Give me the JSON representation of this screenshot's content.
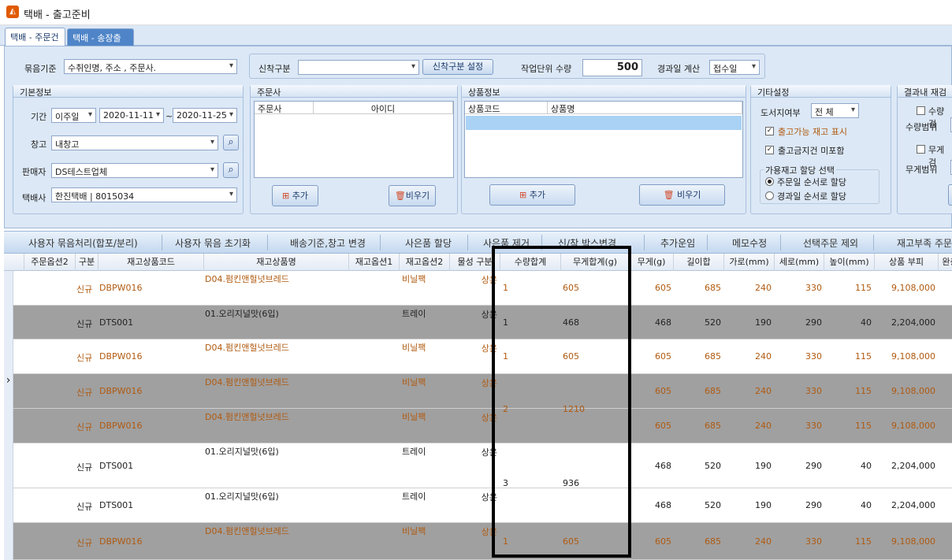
{
  "window": {
    "title": "택배 - 출고준비",
    "icon": "app-logo-icon"
  },
  "tabs": [
    {
      "label": "택배 - 주문건",
      "active": true
    },
    {
      "label": "택배 - 송장출력",
      "active": false
    }
  ],
  "top": {
    "grouping_label": "묶음기준",
    "grouping_value": "수취인명, 주소 , 주문사.",
    "newchak_label": "신착구분",
    "newchak_value": "",
    "newchak_btn": "신착구분 설정",
    "work_unit_label": "작업단위 수량",
    "work_unit_value": "500",
    "elapsed_label": "경과일 계산",
    "elapsed_value": "접수일"
  },
  "basic": {
    "title": "기본정보",
    "period_label": "기간",
    "period_preset": "이주일",
    "date_from": "2020-11-11",
    "tilde": "~",
    "date_to": "2020-11-25",
    "warehouse_label": "창고",
    "warehouse_value": "내창고",
    "seller_label": "판매자",
    "seller_value": "DS테스트업체",
    "courier_label": "택배사",
    "courier_value": "한진택배 | 8015034"
  },
  "orderer": {
    "title": "주문사",
    "col1": "주문사",
    "col2": "아이디",
    "add": "추가",
    "clear": "비우기"
  },
  "product": {
    "title": "상품정보",
    "col1": "상품코드",
    "col2": "상품명",
    "add": "추가",
    "clear": "비우기"
  },
  "etc": {
    "title": "기타설정",
    "island_label": "도서지여부",
    "island_value": "전  체",
    "show_stock": "출고가능 재고 표시",
    "exclude_hold": "출고금지건 미포함",
    "alloc_title": "가용재고 할당 선택",
    "alloc_order": "주문일 순서로 할당",
    "alloc_elapsed": "경과일 순서로 할당"
  },
  "result": {
    "title": "결과내 재검",
    "qty_check": "수량검",
    "qty_range": "수량범위",
    "weight_check": "무게검",
    "weight_range": "무게범위"
  },
  "actions": [
    "사용자 묶음처리(합포/분리)",
    "사용자 묶음 초기화",
    "배송기준,창고 변경",
    "사은품 할당",
    "사은품 제거",
    "신/착 박스변경",
    "추가운임",
    "메모수정",
    "선택주문 제외",
    "재고부족 주문"
  ],
  "columns": [
    "주문옵션2",
    "구분",
    "재고상품코드",
    "재고상품명",
    "재고옵션1",
    "재고옵션2",
    "물성 구분",
    "수량합계",
    "무게합계(g)",
    "무게(g)",
    "길이합",
    "가로(mm)",
    "세로(mm)",
    "높이(mm)",
    "상품 부피",
    "완충"
  ],
  "rows": [
    {
      "bg": "white",
      "tone": "brown",
      "type": "신규",
      "code": "DBPW016",
      "name": "D04.펌킨앤헐넛브레드",
      "opt2": "비닐팩",
      "prop": "상온",
      "qty": "1",
      "wsum": "605",
      "w": "605",
      "len": "685",
      "wd": "240",
      "ht": "330",
      "dp": "115",
      "vol": "9,108,000"
    },
    {
      "bg": "gray",
      "tone": "dark",
      "type": "신규",
      "code": "DTS001",
      "name": "01.오리지널맛(6입)",
      "opt2": "트레이",
      "prop": "상온",
      "qty": "1",
      "wsum": "468",
      "w": "468",
      "len": "520",
      "wd": "190",
      "ht": "290",
      "dp": "40",
      "vol": "2,204,000"
    },
    {
      "bg": "white",
      "tone": "brown",
      "type": "신규",
      "code": "DBPW016",
      "name": "D04.펌킨앤헐넛브레드",
      "opt2": "비닐팩",
      "prop": "상온",
      "qty": "1",
      "wsum": "605",
      "w": "605",
      "len": "685",
      "wd": "240",
      "ht": "330",
      "dp": "115",
      "vol": "9,108,000"
    },
    {
      "bg": "gray",
      "tone": "brown",
      "type": "신규",
      "code": "DBPW016",
      "name": "D04.펌킨앤헐넛브레드",
      "opt2": "비닐팩",
      "prop": "상온",
      "qty": "",
      "wsum": "",
      "w": "605",
      "len": "685",
      "wd": "240",
      "ht": "330",
      "dp": "115",
      "vol": "9,108,000"
    },
    {
      "bg": "gray",
      "tone": "brown",
      "type": "신규",
      "code": "DBPW016",
      "name": "D04.펌킨앤헐넛브레드",
      "opt2": "비닐팩",
      "prop": "상온",
      "qty": "",
      "wsum": "",
      "w": "605",
      "len": "685",
      "wd": "240",
      "ht": "330",
      "dp": "115",
      "vol": "9,108,000"
    },
    {
      "bg": "white",
      "tone": "dark",
      "type": "신규",
      "code": "DTS001",
      "name": "01.오리지널맛(6입)",
      "opt2": "트레이",
      "prop": "상온",
      "qty": "",
      "wsum": "",
      "w": "468",
      "len": "520",
      "wd": "190",
      "ht": "290",
      "dp": "40",
      "vol": "2,204,000"
    },
    {
      "bg": "white",
      "tone": "dark",
      "type": "신규",
      "code": "DTS001",
      "name": "01.오리지널맛(6입)",
      "opt2": "트레이",
      "prop": "상온",
      "qty": "",
      "wsum": "",
      "w": "468",
      "len": "520",
      "wd": "190",
      "ht": "290",
      "dp": "40",
      "vol": "2,204,000"
    },
    {
      "bg": "gray",
      "tone": "brown",
      "type": "신규",
      "code": "DBPW016",
      "name": "D04.펌킨앤헐넛브레드",
      "opt2": "비닐팩",
      "prop": "상온",
      "qty": "1",
      "wsum": "605",
      "w": "605",
      "len": "685",
      "wd": "240",
      "ht": "330",
      "dp": "115",
      "vol": "9,108,000"
    }
  ],
  "merged": [
    {
      "qty": "2",
      "wsum": "1210",
      "tone": "brown"
    },
    {
      "qty": "3",
      "wsum": "936",
      "tone": "dark"
    }
  ]
}
